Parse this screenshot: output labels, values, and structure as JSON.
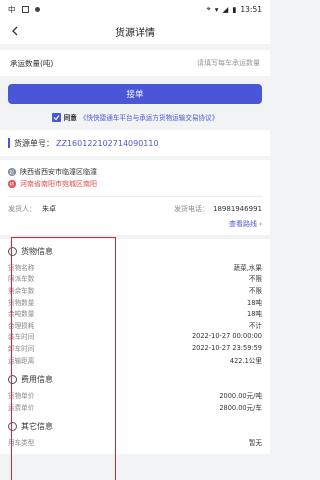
{
  "statusbar": {
    "carrier": "中",
    "time": "13:51"
  },
  "header": {
    "title": "货源详情"
  },
  "quantity": {
    "label": "承运数量(吨)",
    "placeholder": "请填写每车承运数量"
  },
  "accept_button": {
    "label": "接单"
  },
  "agreement": {
    "prefix": "同意",
    "link": "《快快捷通车平台与承运方货物运输交易协议》"
  },
  "order": {
    "label": "货源单号：",
    "value": "ZZ160122102714090110"
  },
  "addresses": {
    "origin": "陕西省西安市临潼区临潼",
    "destination": "河南省南阳市宛城区南阳",
    "origin_pin": "起",
    "dest_pin": "终"
  },
  "shipper": {
    "name_label": "发货人：",
    "name": "朱卓",
    "phone_label": "发货电话：",
    "phone": "18981946991"
  },
  "route_link": "查看路线 ›",
  "cargo": {
    "title": "货物信息",
    "rows": [
      {
        "k": "货物名称",
        "v": "蔬菜,水果"
      },
      {
        "k": "限派车数",
        "v": "不限"
      },
      {
        "k": "剩余车数",
        "v": "不限"
      },
      {
        "k": "货物数量",
        "v": "18吨"
      },
      {
        "k": "余吨数量",
        "v": "18吨"
      },
      {
        "k": "合理损耗",
        "v": "不计"
      },
      {
        "k": "装车时间",
        "v": "2022-10-27 00:00:00"
      },
      {
        "k": "卸车时间",
        "v": "2022-10-27 23:59:59"
      },
      {
        "k": "运输距离",
        "v": "422.1公里"
      }
    ]
  },
  "fees": {
    "title": "费用信息",
    "rows": [
      {
        "k": "货物单价",
        "v": "2000.00元/吨"
      },
      {
        "k": "运费单价",
        "v": "2800.00元/车"
      }
    ]
  },
  "other": {
    "title": "其它信息",
    "rows": [
      {
        "k": "用车类型",
        "v": "暂无"
      }
    ]
  },
  "colors": {
    "primary": "#4a55d8",
    "destination": "#e3464a",
    "annotation": "#d9262c"
  }
}
